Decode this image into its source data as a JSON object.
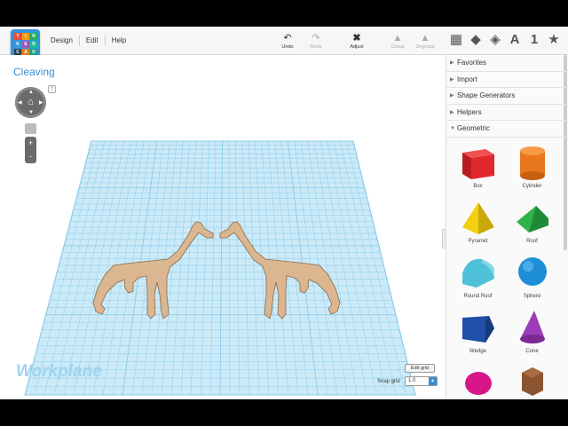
{
  "menu": [
    "Design",
    "Edit",
    "Help"
  ],
  "logo_letters": [
    "T",
    "I",
    "N",
    "K",
    "E",
    "R",
    "C",
    "A",
    "D"
  ],
  "toolbar": {
    "undo": "Undo",
    "redo": "Redo",
    "adjust": "Adjust",
    "group": "Group",
    "ungroup": "Ungroup"
  },
  "view_icons": [
    "A",
    "1"
  ],
  "design_title": "Cleaving",
  "help_mark": "?",
  "zoom": {
    "in": "+",
    "out": "-"
  },
  "workplane_label": "Workplane",
  "edit_grid": "Edit grid",
  "snap": {
    "label": "Snap grid",
    "value": "1.0"
  },
  "sidebar": {
    "sections": [
      "Favorites",
      "Import",
      "Shape Generators",
      "Helpers",
      "Geometric"
    ],
    "shapes": [
      {
        "label": "Box",
        "color": "#e0282e"
      },
      {
        "label": "Cylinder",
        "color": "#e8771d"
      },
      {
        "label": "Pyramid",
        "color": "#f2cf0f"
      },
      {
        "label": "Roof",
        "color": "#2fb34a"
      },
      {
        "label": "Round Roof",
        "color": "#4fc1d8"
      },
      {
        "label": "Sphere",
        "color": "#1e8fd6"
      },
      {
        "label": "Wedge",
        "color": "#1f4fa8"
      },
      {
        "label": "Cone",
        "color": "#9b3db8"
      },
      {
        "label": "",
        "color": "#d8168a"
      },
      {
        "label": "",
        "color": "#8a5530"
      }
    ]
  },
  "colors": {
    "grid": "#bfe3f5",
    "grid_line": "#8ccbe8",
    "accent": "#3a8fd0",
    "model": "#dcb690"
  }
}
